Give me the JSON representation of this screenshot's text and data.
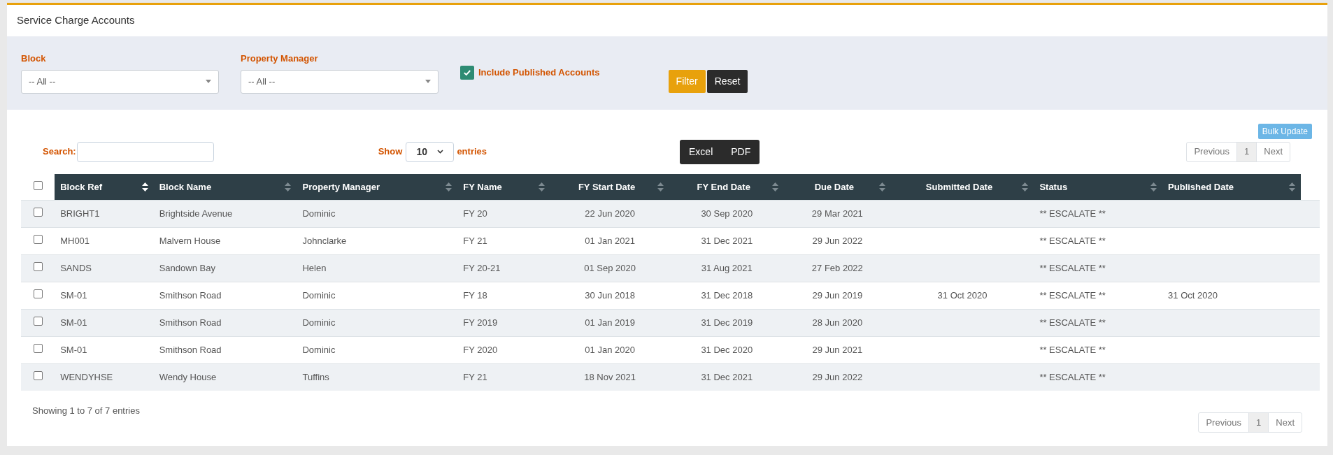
{
  "title": "Service Charge Accounts",
  "filters": {
    "block": {
      "label": "Block",
      "value": "-- All --"
    },
    "manager": {
      "label": "Property Manager",
      "value": "-- All --"
    },
    "include_published": {
      "label": "Include Published Accounts",
      "checked": true
    },
    "buttons": [
      {
        "label": "Filter",
        "kind": "primary"
      },
      {
        "label": "Reset",
        "kind": "dark"
      }
    ]
  },
  "bulk_update": "Bulk Update",
  "search": {
    "label": "Search:"
  },
  "length": {
    "before": "Show",
    "value": "10",
    "after": "entries"
  },
  "exports": [
    "Excel",
    "PDF"
  ],
  "pagination_top": {
    "previous": "Previous",
    "pages": [
      {
        "label": "1",
        "selected": true
      }
    ],
    "next": "Next"
  },
  "table": {
    "select_all": {
      "checked": false
    },
    "columns": [
      {
        "label": "Block Ref",
        "kind": "text",
        "sorted": true
      },
      {
        "label": "Block Name",
        "kind": "text",
        "sorted": false
      },
      {
        "label": "Property Manager",
        "kind": "text",
        "sorted": false
      },
      {
        "label": "FY Name",
        "kind": "text",
        "sorted": false
      },
      {
        "label": "FY Start Date",
        "kind": "date",
        "sorted": false
      },
      {
        "label": "FY End Date",
        "kind": "date",
        "sorted": false
      },
      {
        "label": "Due Date",
        "kind": "date",
        "sorted": false
      },
      {
        "label": "Submitted Date",
        "kind": "date",
        "sorted": false
      },
      {
        "label": "Status",
        "kind": "text",
        "sorted": false
      },
      {
        "label": "Published Date",
        "kind": "text",
        "sorted": false
      }
    ],
    "rows": [
      {
        "checked": false,
        "cells": [
          "BRIGHT1",
          "Brightside Avenue",
          "Dominic",
          "FY 20",
          "22 Jun 2020",
          "30 Sep 2020",
          "29 Mar 2021",
          "",
          "** ESCALATE **",
          ""
        ]
      },
      {
        "checked": false,
        "cells": [
          "MH001",
          "Malvern House",
          "Johnclarke",
          "FY 21",
          "01 Jan 2021",
          "31 Dec 2021",
          "29 Jun 2022",
          "",
          "** ESCALATE **",
          ""
        ]
      },
      {
        "checked": false,
        "cells": [
          "SANDS",
          "Sandown Bay",
          "Helen",
          "FY 20-21",
          "01 Sep 2020",
          "31 Aug 2021",
          "27 Feb 2022",
          "",
          "** ESCALATE **",
          ""
        ]
      },
      {
        "checked": false,
        "cells": [
          "SM-01",
          "Smithson Road",
          "Dominic",
          "FY 18",
          "30 Jun 2018",
          "31 Dec 2018",
          "29 Jun 2019",
          "31 Oct 2020",
          "** ESCALATE **",
          "31 Oct 2020"
        ]
      },
      {
        "checked": false,
        "cells": [
          "SM-01",
          "Smithson Road",
          "Dominic",
          "FY 2019",
          "01 Jan 2019",
          "31 Dec 2019",
          "28 Jun 2020",
          "",
          "** ESCALATE **",
          ""
        ]
      },
      {
        "checked": false,
        "cells": [
          "SM-01",
          "Smithson Road",
          "Dominic",
          "FY 2020",
          "01 Jan 2020",
          "31 Dec 2020",
          "29 Jun 2021",
          "",
          "** ESCALATE **",
          ""
        ]
      },
      {
        "checked": false,
        "cells": [
          "WENDYHSE",
          "Wendy House",
          "Tuffins",
          "FY 21",
          "18 Nov 2021",
          "31 Dec 2021",
          "29 Jun 2022",
          "",
          "** ESCALATE **",
          ""
        ]
      }
    ]
  },
  "info": "Showing 1 to 7 of 7 entries",
  "pagination_bottom": {
    "previous": "Previous",
    "pages": [
      {
        "label": "1",
        "selected": true
      }
    ],
    "next": "Next"
  }
}
